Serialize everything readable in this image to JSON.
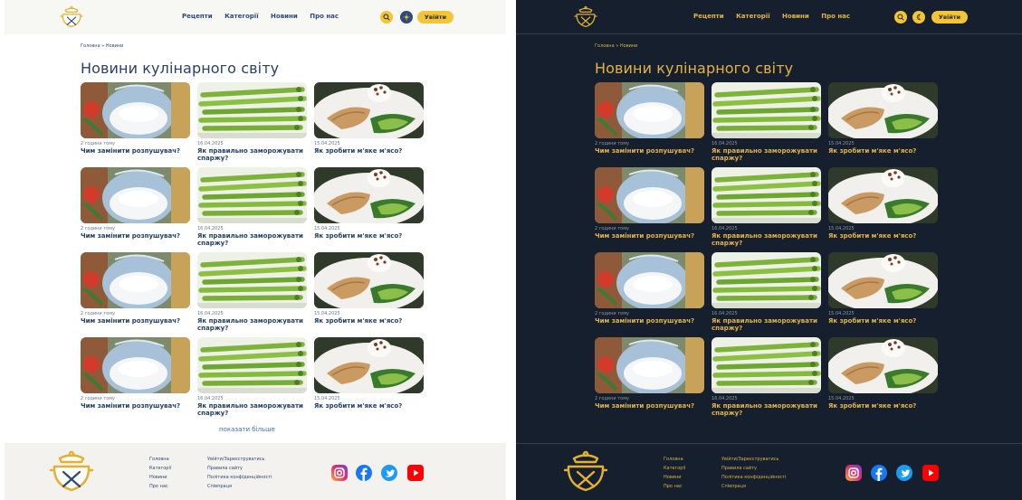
{
  "header": {
    "nav": [
      "Рецепти",
      "Категорії",
      "Новини",
      "Про нас"
    ],
    "search_icon": "search-icon",
    "theme_light_icon": "sun-icon",
    "theme_dark_icon": "moon-icon",
    "login_label": "Увійти"
  },
  "breadcrumb": "Головна » Новини",
  "page_title": "Новини кулінарного світу",
  "articles": [
    {
      "date": "2 години тому",
      "title": "Чим замінити розпушувач?",
      "image": "baking-powder-bowl"
    },
    {
      "date": "16.04.2025",
      "title": "Як правильно заморожувати спаржу?",
      "image": "asparagus"
    },
    {
      "date": "15.04.2025",
      "title": "Як зробити м'яке м'ясо?",
      "image": "meat-plate"
    },
    {
      "date": "2 години тому",
      "title": "Чим замінити розпушувач?",
      "image": "baking-powder-bowl"
    },
    {
      "date": "16.04.2025",
      "title": "Як правильно заморожувати спаржу?",
      "image": "asparagus"
    },
    {
      "date": "15.04.2025",
      "title": "Як зробити м'яке м'ясо?",
      "image": "meat-plate"
    },
    {
      "date": "2 години тому",
      "title": "Чим замінити розпушувач?",
      "image": "baking-powder-bowl"
    },
    {
      "date": "16.04.2025",
      "title": "Як правильно заморожувати спаржу?",
      "image": "asparagus"
    },
    {
      "date": "15.04.2025",
      "title": "Як зробити м'яке м'ясо?",
      "image": "meat-plate"
    },
    {
      "date": "2 години тому",
      "title": "Чим замінити розпушувач?",
      "image": "baking-powder-bowl"
    },
    {
      "date": "16.04.2025",
      "title": "Як правильно заморожувати спаржу?",
      "image": "asparagus"
    },
    {
      "date": "15.04.2025",
      "title": "Як зробити м'яке м'ясо?",
      "image": "meat-plate"
    }
  ],
  "show_more_label": "показати більше",
  "footer": {
    "col1": [
      "Головна",
      "Категорії",
      "Новини",
      "Про нас"
    ],
    "col2": [
      "Увійти/Зареєструватись",
      "Правила сайту",
      "Політика конфіденційності",
      "Співпраця"
    ],
    "social": [
      "instagram-icon",
      "facebook-icon",
      "twitter-icon",
      "youtube-icon"
    ]
  },
  "colors": {
    "accent": "#f3c536",
    "light_text": "#2f4a78",
    "dark_bg": "#161f2d",
    "dark_text": "#e3b445",
    "link": "#3d6fb6"
  }
}
